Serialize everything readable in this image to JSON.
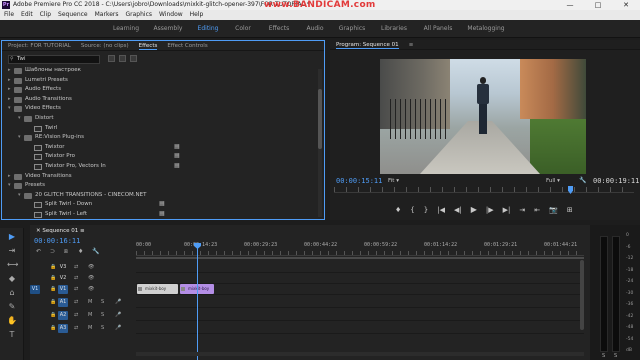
{
  "window": {
    "title": "Adobe Premiere Pro CC 2018 - C:\\Users\\jobro\\Downloads\\mixkit-glitch-opener-397\\FOR TUTORIAL *",
    "watermark": "www.BANDICAM.com",
    "minimize": "—",
    "restore": "□",
    "close": "✕",
    "app_icon": "Pr"
  },
  "menu": [
    "File",
    "Edit",
    "Clip",
    "Sequence",
    "Markers",
    "Graphics",
    "Window",
    "Help"
  ],
  "workspaces": {
    "items": [
      {
        "label": "Learning",
        "active": false
      },
      {
        "label": "Assembly",
        "active": false
      },
      {
        "label": "Editing",
        "active": true
      },
      {
        "label": "Color",
        "active": false
      },
      {
        "label": "Effects",
        "active": false
      },
      {
        "label": "Audio",
        "active": false
      },
      {
        "label": "Graphics",
        "active": false
      },
      {
        "label": "Libraries",
        "active": false
      },
      {
        "label": "All Panels",
        "active": false
      },
      {
        "label": "Metalogging",
        "active": false
      }
    ],
    "accent": "#4f9cf5"
  },
  "effects_panel": {
    "tabs": [
      {
        "label": "Project: FOR TUTORIAL",
        "active": false
      },
      {
        "label": "Source: (no clips)",
        "active": false
      },
      {
        "label": "Effects",
        "active": true
      },
      {
        "label": "Effect Controls",
        "active": false
      }
    ],
    "search_value": "Twi",
    "tree": [
      {
        "label": "Шаблоны настроек",
        "level": 0,
        "type": "folder",
        "open": false
      },
      {
        "label": "Lumetri Presets",
        "level": 0,
        "type": "folder",
        "open": false
      },
      {
        "label": "Audio Effects",
        "level": 0,
        "type": "folder",
        "open": false
      },
      {
        "label": "Audio Transitions",
        "level": 0,
        "type": "folder",
        "open": false
      },
      {
        "label": "Video Effects",
        "level": 0,
        "type": "folder",
        "open": true
      },
      {
        "label": "Distort",
        "level": 1,
        "type": "folder",
        "open": true
      },
      {
        "label": "Twirl",
        "level": 2,
        "type": "effect",
        "badge": false
      },
      {
        "label": "RE:Vision Plug-ins",
        "level": 1,
        "type": "folder",
        "open": true
      },
      {
        "label": "Twixtor",
        "level": 2,
        "type": "effect",
        "badge": true
      },
      {
        "label": "Twixtor Pro",
        "level": 2,
        "type": "effect",
        "badge": true
      },
      {
        "label": "Twixtor Pro, Vectors In",
        "level": 2,
        "type": "effect",
        "badge": true
      },
      {
        "label": "Video Transitions",
        "level": 0,
        "type": "folder",
        "open": false
      },
      {
        "label": "Presets",
        "level": 0,
        "type": "folder",
        "open": true
      },
      {
        "label": "20 GLITCH TRANSITIONS - CINECOM.NET",
        "level": 1,
        "type": "folder",
        "open": true
      },
      {
        "label": "Split Twirl - Down",
        "level": 2,
        "type": "effect",
        "badge2": true
      },
      {
        "label": "Split Twirl - Left",
        "level": 2,
        "type": "effect",
        "badge2": true
      }
    ]
  },
  "program_monitor": {
    "title": "Program: Sequence 01",
    "menu_icon": "≡",
    "timecode": "00:00:15:11",
    "fit": "Fit",
    "fit_arrow": "▾",
    "quality": "Full",
    "quality_arrow": "▾",
    "duration": "00:00:19:11",
    "wrench_icon": "🔧",
    "transport": [
      "♦",
      "{",
      "}",
      "|◀",
      "◀|",
      "▶",
      "|▶",
      "▶|",
      "⇥",
      "⇤",
      "📷",
      "⊞"
    ]
  },
  "timeline": {
    "tab": "Sequence 01",
    "tab_icon": "≡",
    "close_icon": "✕",
    "timecode": "00:00:16:11",
    "ruler": [
      "00:00",
      "00:00:14:23",
      "00:00:29:23",
      "00:00:44:22",
      "00:00:59:22",
      "00:01:14:22",
      "00:01:29:21",
      "00:01:44:21"
    ],
    "video_tracks": [
      {
        "name": "V3",
        "src": "",
        "targeted": false
      },
      {
        "name": "V2",
        "src": "",
        "targeted": false
      },
      {
        "name": "V1",
        "src": "V1",
        "targeted": true
      }
    ],
    "audio_tracks": [
      {
        "name": "A1",
        "src": "",
        "targeted": true
      },
      {
        "name": "A2",
        "src": "",
        "targeted": true
      },
      {
        "name": "A3",
        "src": "",
        "targeted": true
      }
    ],
    "lock_icon": "🔒",
    "sync_icon": "⇄",
    "eye_icon": "👁",
    "m_label": "M",
    "s_label": "S",
    "mic_icon": "🎤",
    "clips": [
      {
        "label": "mixkit-boy",
        "color": "#d0d0d0"
      },
      {
        "label": "mixkit-boy",
        "color": "#b48ee6"
      }
    ],
    "header_icons": [
      "↶",
      "⊃",
      "⧈",
      "♦",
      "🔧"
    ]
  },
  "meter": {
    "scale": [
      "0",
      "-6",
      "-12",
      "-18",
      "-24",
      "-30",
      "-36",
      "-42",
      "-48",
      "-54",
      "dB"
    ],
    "labels": [
      "S",
      "S"
    ]
  },
  "tools": [
    "▶",
    "⇥",
    "⟷",
    "◆",
    "⌂",
    "✎",
    "✋",
    "T"
  ]
}
